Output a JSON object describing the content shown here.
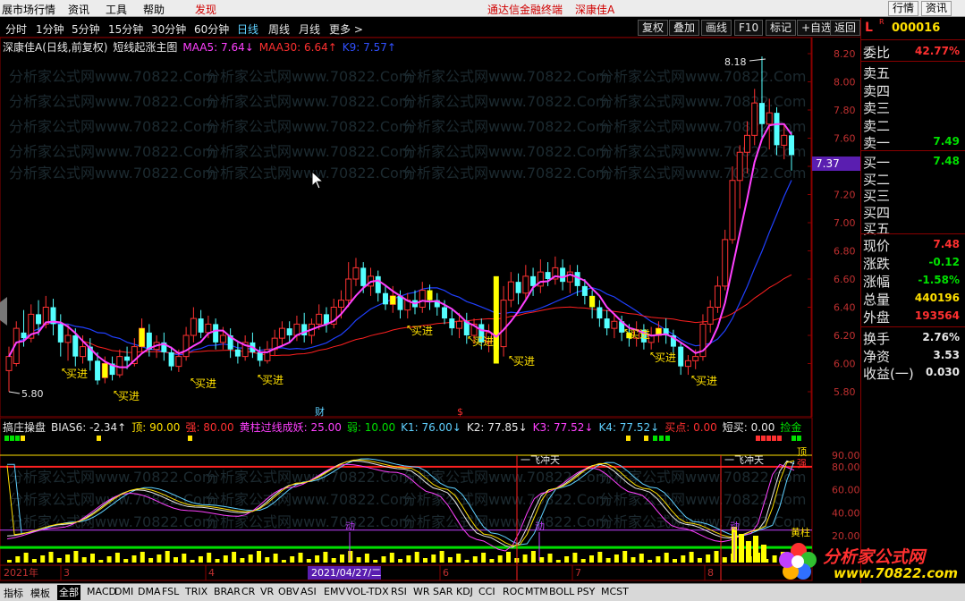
{
  "menubar": {
    "items": [
      "展市场行情",
      "资讯",
      "工具",
      "帮助",
      "发现"
    ],
    "center_link": "通达信金融终端",
    "stock_name": "深康佳A",
    "right_buttons": [
      "行情",
      "资讯"
    ]
  },
  "periodbar": {
    "periods": [
      "分时",
      "1分钟",
      "5分钟",
      "15分钟",
      "30分钟",
      "60分钟",
      "日线",
      "周线",
      "月线",
      "更多 >"
    ],
    "active_period": "日线",
    "tools": [
      "复权",
      "叠加",
      "画线",
      "F10",
      "标记",
      "+自选",
      "返回"
    ]
  },
  "main_info": {
    "stock": "深康佳A(日线,前复权)",
    "formula": "短线起涨主图",
    "maa5": "MAA5: 7.64↓",
    "maa30": "MAA30: 6.64↑",
    "k9": "K9: 7.57↑"
  },
  "price_axis": [
    "8.20",
    "8.00",
    "7.80",
    "7.60",
    "7.40",
    "7.20",
    "7.00",
    "6.80",
    "6.60",
    "6.40",
    "6.20",
    "6.00",
    "5.80"
  ],
  "current_price_tag": "7.37",
  "annotations": {
    "high": "8.18",
    "low": "5.80",
    "buy_label": "买进",
    "finance_mark": "财",
    "dollar_mark": "$"
  },
  "indicator_info": {
    "name": "搞庄操盘",
    "bias": "BIAS6: -2.34↑",
    "top": "顶: 90.00",
    "strong": "强: 80.00",
    "yellow": "黄柱过线成妖: 25.00",
    "weak": "弱: 10.00",
    "k1": "K1: 76.00↓",
    "k2": "K2: 77.85↓",
    "k3": "K3: 77.52↓",
    "k4": "K4: 77.52↓",
    "buy_point": "买点: 0.00",
    "short_buy": "短买: 0.00",
    "pick_gold": "捡金"
  },
  "indicator_axis": [
    "90.00",
    "80.00",
    "60.00",
    "40.00",
    "20.00"
  ],
  "indicator_labels": {
    "fly": "一飞冲天",
    "move": "动",
    "top": "顶",
    "strong": "强",
    "yellow_bar": "黄柱"
  },
  "time_axis": {
    "year": "2021年",
    "months": [
      "3",
      "4",
      "6",
      "7",
      "8"
    ],
    "cursor_date": "2021/04/27/二"
  },
  "quote_panel": {
    "code": "000016",
    "flag": "L",
    "sup": "R",
    "wei_bi_label": "委比",
    "wei_bi_value": "42.77%",
    "sell_levels": [
      {
        "label": "卖五",
        "value": ""
      },
      {
        "label": "卖四",
        "value": ""
      },
      {
        "label": "卖三",
        "value": ""
      },
      {
        "label": "卖二",
        "value": ""
      },
      {
        "label": "卖一",
        "value": "7.49"
      }
    ],
    "buy_levels": [
      {
        "label": "买一",
        "value": "7.48"
      },
      {
        "label": "买二",
        "value": ""
      },
      {
        "label": "买三",
        "value": ""
      },
      {
        "label": "买四",
        "value": ""
      },
      {
        "label": "买五",
        "value": ""
      }
    ],
    "stats": [
      {
        "label": "现价",
        "value": "7.48",
        "color": "#ff3030"
      },
      {
        "label": "涨跌",
        "value": "-0.12",
        "color": "#00e000"
      },
      {
        "label": "涨幅",
        "value": "-1.58%",
        "color": "#00e000"
      },
      {
        "label": "总量",
        "value": "440196",
        "color": "#ffe000"
      },
      {
        "label": "外盘",
        "value": "193564",
        "color": "#ff3030"
      }
    ],
    "stats2": [
      {
        "label": "换手",
        "value": "2.76%"
      },
      {
        "label": "净资",
        "value": "3.53"
      },
      {
        "label": "收益(一)",
        "value": "0.030"
      }
    ]
  },
  "tabbar": {
    "items": [
      "指标",
      "模板",
      "全部",
      "MACD",
      "DMI",
      "DMA",
      "FSL",
      "TRIX",
      "BRAR",
      "CR",
      "VR",
      "OBV",
      "ASI",
      "EMV",
      "VOL-TDX",
      "RSI",
      "WR",
      "SAR",
      "KDJ",
      "CCI",
      "ROC",
      "MTM",
      "BOLL",
      "PSY",
      "MCST"
    ],
    "active": "全部"
  },
  "logo": {
    "title": "分析家公式网",
    "url": "www.70822.com"
  },
  "watermark": "分析家公式网www.70822.Com",
  "colors": {
    "up": "#ff3232",
    "down": "#54ffff",
    "ma_fast": "#ff40ff",
    "ma_slow": "#ff2020",
    "k9": "#2040ff",
    "yellow_bar": "#ffff00"
  }
}
